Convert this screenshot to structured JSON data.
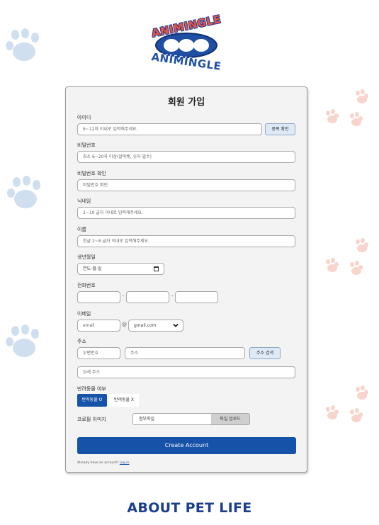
{
  "brand": {
    "logo_top": "ANIMINGLE",
    "logo_bottom": "ANIMINGLE"
  },
  "form": {
    "title": "회원 가입",
    "userid": {
      "label": "아이디",
      "placeholder": "6~12자 이내로 입력해주세요.",
      "check_button": "중복 확인"
    },
    "password": {
      "label": "비밀번호",
      "placeholder": "최소 6~20자 이상(알파벳, 숫자 필수)"
    },
    "password_confirm": {
      "label": "비밀번호 확인",
      "placeholder": "비밀번호 확인"
    },
    "nickname": {
      "label": "닉네임",
      "placeholder": "2~10 글자 이내로 입력해주세요."
    },
    "name": {
      "label": "이름",
      "placeholder": "한글 2~8 글자 이내로 입력해주세요."
    },
    "birth": {
      "label": "생년월일",
      "placeholder": "연도-월-일"
    },
    "phone": {
      "label": "전화번호",
      "separator": "-"
    },
    "email": {
      "label": "이메일",
      "local_placeholder": "email",
      "at": "@",
      "domain_selected": "gmail.com"
    },
    "address": {
      "label": "주소",
      "zip_placeholder": "우편번호",
      "addr_placeholder": "주소",
      "search_button": "주소 검색",
      "detail_placeholder": "상세 주소"
    },
    "pet": {
      "label": "반려동물 여부",
      "yes_label": "반려동물 O",
      "no_label": "반려동물 X"
    },
    "profile": {
      "label": "프로필 이미지",
      "file_name": "첨부파일",
      "upload_button": "파일 업로드"
    },
    "submit_label": "Create Account",
    "login_prompt": "Already have an account?",
    "login_link": "Log in"
  },
  "footer": {
    "text": "ABOUT PET LIFE"
  },
  "colors": {
    "primary": "#1652a8",
    "footer": "#1b3f8f",
    "paw_blue": "#cfdff0",
    "paw_pink": "#f8d5cc"
  }
}
